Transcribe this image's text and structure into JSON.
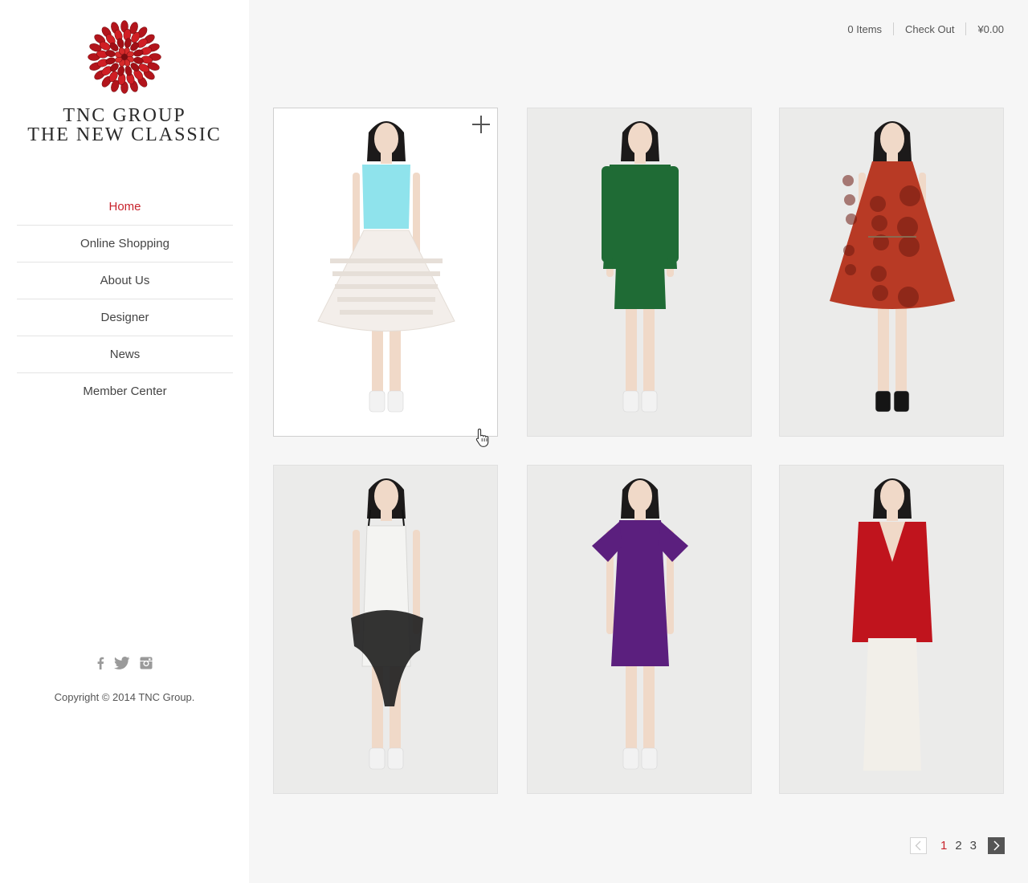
{
  "brand": {
    "line1": "TNC GROUP",
    "line2": "THE NEW CLASSIC",
    "logo_icon": "red-flower-logo-icon"
  },
  "nav": {
    "items": [
      {
        "label": "Home",
        "active": true
      },
      {
        "label": "Online Shopping",
        "active": false
      },
      {
        "label": "About Us",
        "active": false
      },
      {
        "label": "Designer",
        "active": false
      },
      {
        "label": "News",
        "active": false
      },
      {
        "label": "Member Center",
        "active": false
      }
    ]
  },
  "social": {
    "icons": [
      "facebook-icon",
      "twitter-icon",
      "instagram-icon"
    ]
  },
  "footer": {
    "copyright": "Copyright © 2014 TNC Group."
  },
  "cart": {
    "items_label": "0 Items",
    "checkout_label": "Check Out",
    "total": "¥0.00"
  },
  "products": [
    {
      "outfit": "cyan sleeveless top with white sheer skirt",
      "colors": {
        "top": "#8fe3ec",
        "bottom": "#f3eeea"
      }
    },
    {
      "outfit": "green jacket with green shorts",
      "colors": {
        "top": "#1f6b35",
        "bottom": "#1f6b35"
      }
    },
    {
      "outfit": "red printed cape dress",
      "colors": {
        "top": "#b83a25",
        "bottom": "#b83a25"
      }
    },
    {
      "outfit": "white dress with black sheer wrap",
      "colors": {
        "top": "#f4f4f2",
        "bottom": "#222222"
      }
    },
    {
      "outfit": "purple flutter-sleeve dress",
      "colors": {
        "top": "#5b1f7e",
        "bottom": "#5b1f7e"
      }
    },
    {
      "outfit": "red blazer with white trousers",
      "colors": {
        "top": "#c0141d",
        "bottom": "#f2efe9"
      }
    }
  ],
  "pagination": {
    "pages": [
      "1",
      "2",
      "3"
    ],
    "current": "1"
  },
  "colors": {
    "accent": "#c8232c",
    "sidebar_bg": "#ffffff",
    "content_bg": "#f6f6f6"
  }
}
